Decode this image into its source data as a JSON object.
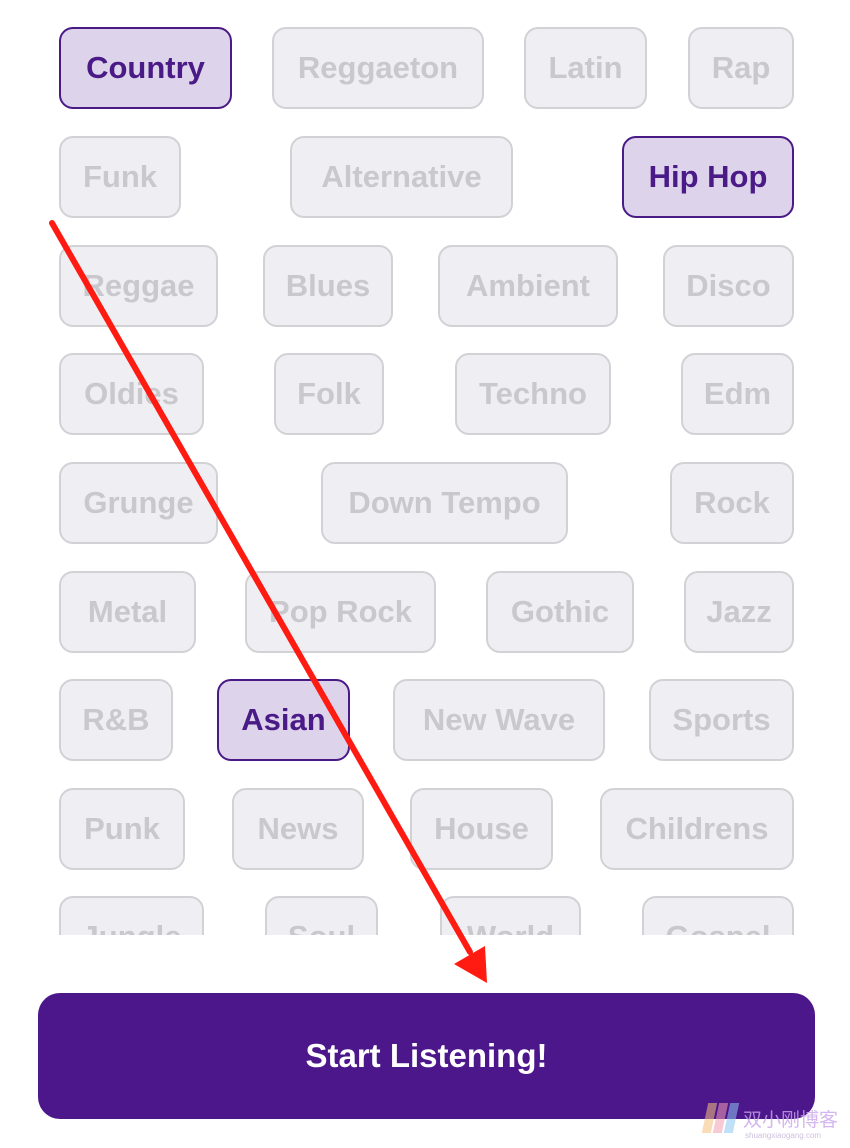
{
  "genres": [
    {
      "label": "Country",
      "selected": true
    },
    {
      "label": "Reggaeton",
      "selected": false
    },
    {
      "label": "Latin",
      "selected": false
    },
    {
      "label": "Rap",
      "selected": false
    },
    {
      "label": "Funk",
      "selected": false
    },
    {
      "label": "Alternative",
      "selected": false
    },
    {
      "label": "Hip Hop",
      "selected": true
    },
    {
      "label": "Reggae",
      "selected": false
    },
    {
      "label": "Blues",
      "selected": false
    },
    {
      "label": "Ambient",
      "selected": false
    },
    {
      "label": "Disco",
      "selected": false
    },
    {
      "label": "Oldies",
      "selected": false
    },
    {
      "label": "Folk",
      "selected": false
    },
    {
      "label": "Techno",
      "selected": false
    },
    {
      "label": "Edm",
      "selected": false
    },
    {
      "label": "Grunge",
      "selected": false
    },
    {
      "label": "Down Tempo",
      "selected": false
    },
    {
      "label": "Rock",
      "selected": false
    },
    {
      "label": "Metal",
      "selected": false
    },
    {
      "label": "Pop Rock",
      "selected": false
    },
    {
      "label": "Gothic",
      "selected": false
    },
    {
      "label": "Jazz",
      "selected": false
    },
    {
      "label": "R&B",
      "selected": false
    },
    {
      "label": "Asian",
      "selected": true
    },
    {
      "label": "New Wave",
      "selected": false
    },
    {
      "label": "Sports",
      "selected": false
    },
    {
      "label": "Punk",
      "selected": false
    },
    {
      "label": "News",
      "selected": false
    },
    {
      "label": "House",
      "selected": false
    },
    {
      "label": "Childrens",
      "selected": false
    },
    {
      "label": "Jungle",
      "selected": false
    },
    {
      "label": "Soul",
      "selected": false
    },
    {
      "label": "World",
      "selected": false
    },
    {
      "label": "Gospel",
      "selected": false
    }
  ],
  "start_button": {
    "label": "Start Listening!"
  },
  "watermark": {
    "text": "双小刚博客",
    "subtext": "shuangxiaogang.com"
  },
  "colors": {
    "accent": "#4d178c",
    "selected_bg": "#ddd3ea",
    "unselected_bg": "#efeff3",
    "unselected_text": "#c9c9cd",
    "annotation_arrow": "#ff1a12"
  }
}
